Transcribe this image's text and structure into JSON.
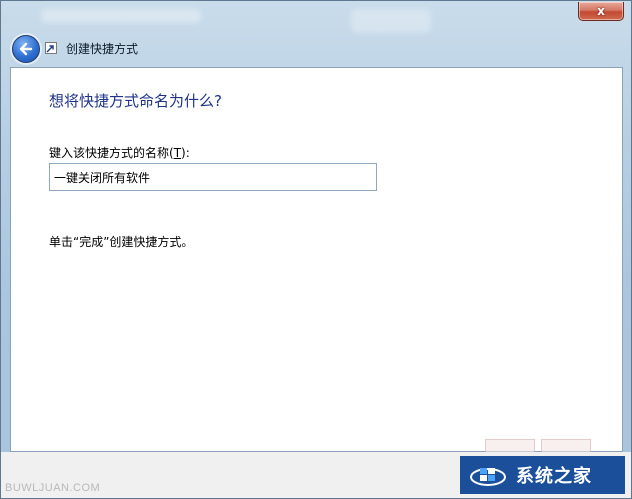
{
  "window": {
    "title": "创建快捷方式",
    "close_label": "x"
  },
  "page": {
    "heading": "想将快捷方式命名为什么?",
    "field_label_prefix": "键入该快捷方式的名称(",
    "field_label_hotkey": "T",
    "field_label_suffix": "):",
    "name_value": "一键关闭所有软件",
    "hint": "单击“完成”创建快捷方式。"
  },
  "watermark": {
    "left_text": "BUWLJUAN.COM",
    "brand_text": "系统之家"
  },
  "icons": [
    "back-arrow-icon",
    "shortcut-icon",
    "close-icon",
    "brand-logo-icon"
  ],
  "colors": {
    "heading": "#1e3287",
    "close_button": "#c24a31",
    "brand": "#1c4f9a"
  }
}
